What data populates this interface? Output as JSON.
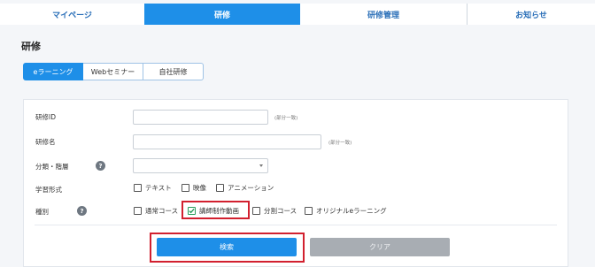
{
  "nav": {
    "tabs": [
      {
        "label": "マイページ"
      },
      {
        "label": "研修",
        "active": true
      },
      {
        "label": "研修管理"
      },
      {
        "label": "お知らせ"
      }
    ]
  },
  "page": {
    "title": "研修"
  },
  "subtabs": [
    {
      "label": "eラーニング",
      "active": true
    },
    {
      "label": "Webセミナー"
    },
    {
      "label": "自社研修"
    }
  ],
  "form": {
    "training_id": {
      "label": "研修ID",
      "value": "",
      "hint": "(部分一致)"
    },
    "training_name": {
      "label": "研修名",
      "value": "",
      "hint": "(部分一致)"
    },
    "category": {
      "label": "分類・階層",
      "help_icon": "question-icon",
      "value": ""
    },
    "learning_format": {
      "label": "学習形式",
      "options": [
        {
          "label": "テキスト",
          "checked": false
        },
        {
          "label": "映像",
          "checked": false
        },
        {
          "label": "アニメーション",
          "checked": false
        }
      ]
    },
    "type": {
      "label": "種別",
      "help_icon": "question-icon",
      "options": [
        {
          "label": "通常コース",
          "checked": false
        },
        {
          "label": "講師制作動画",
          "checked": true
        },
        {
          "label": "分割コース",
          "checked": false
        },
        {
          "label": "オリジナルeラーニング",
          "checked": false
        }
      ]
    }
  },
  "actions": {
    "search_label": "検索",
    "clear_label": "クリア"
  },
  "colors": {
    "accent": "#1e8fe8",
    "highlight": "#d2202f",
    "check": "#2a9d5c",
    "disabled": "#a8adb3"
  }
}
